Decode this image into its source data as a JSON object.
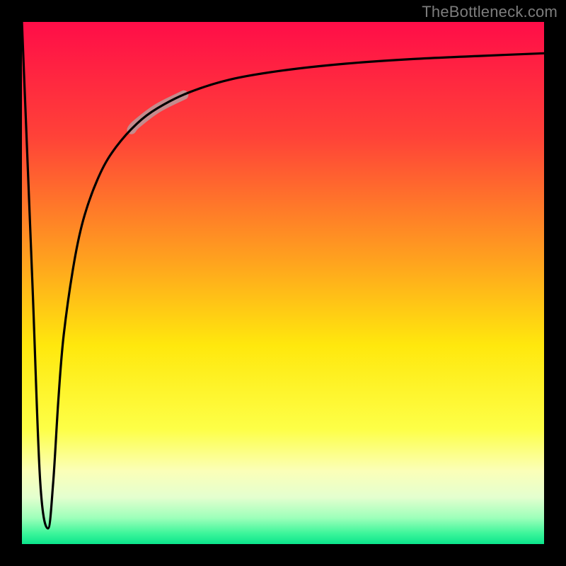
{
  "watermark": "TheBottleneck.com",
  "chart_data": {
    "type": "line",
    "title": "",
    "xlabel": "",
    "ylabel": "",
    "xlim": [
      0,
      100
    ],
    "ylim": [
      0,
      100
    ],
    "grid": false,
    "legend": false,
    "gradient_stops": [
      {
        "pct": 0,
        "color": "#ff0d48"
      },
      {
        "pct": 22,
        "color": "#ff4238"
      },
      {
        "pct": 45,
        "color": "#ff9f1f"
      },
      {
        "pct": 62,
        "color": "#ffe80d"
      },
      {
        "pct": 78,
        "color": "#fdff47"
      },
      {
        "pct": 86,
        "color": "#fbffb8"
      },
      {
        "pct": 91,
        "color": "#e4ffcf"
      },
      {
        "pct": 95,
        "color": "#9dffba"
      },
      {
        "pct": 98,
        "color": "#3bf59a"
      },
      {
        "pct": 100,
        "color": "#0be58c"
      }
    ],
    "series": [
      {
        "name": "curve",
        "x": [
          0.0,
          2.0,
          3.5,
          5.0,
          6.0,
          7.0,
          8.0,
          10.0,
          12.0,
          15.0,
          18.0,
          22.0,
          26.0,
          32.0,
          40.0,
          50.0,
          62.0,
          75.0,
          88.0,
          100.0
        ],
        "y": [
          100.0,
          50.0,
          12.0,
          3.0,
          12.0,
          28.0,
          40.0,
          54.0,
          63.0,
          71.0,
          76.0,
          80.5,
          83.5,
          86.5,
          89.0,
          90.7,
          92.0,
          92.9,
          93.5,
          94.0
        ]
      }
    ],
    "highlight": {
      "description": "thick pale segment along curve",
      "x_range": [
        21.0,
        31.0
      ],
      "y_range": [
        79.0,
        86.0
      ]
    }
  }
}
